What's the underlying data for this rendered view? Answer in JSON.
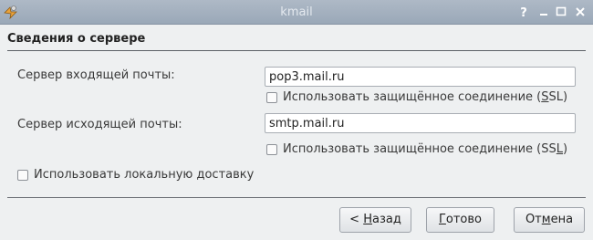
{
  "window": {
    "title": "kmail"
  },
  "header": {
    "title": "Сведения о сервере"
  },
  "incoming": {
    "label": "Сервер входящей почты:",
    "value": "pop3.mail.ru",
    "ssl_pre": "Использовать защищённое соединение (",
    "ssl_u": "S",
    "ssl_post": "SL)"
  },
  "outgoing": {
    "label": "Сервер исходящей почты:",
    "value": "smtp.mail.ru",
    "ssl_pre": "Использовать защищённое соединение (SS",
    "ssl_u": "L",
    "ssl_post": ")"
  },
  "local_delivery": {
    "label": "Использовать локальную доставку"
  },
  "buttons": {
    "back_pre": "< ",
    "back_u": "Н",
    "back_post": "азад",
    "finish_u": "Г",
    "finish_post": "отово",
    "cancel_pre": "От",
    "cancel_u": "м",
    "cancel_post": "ена"
  }
}
